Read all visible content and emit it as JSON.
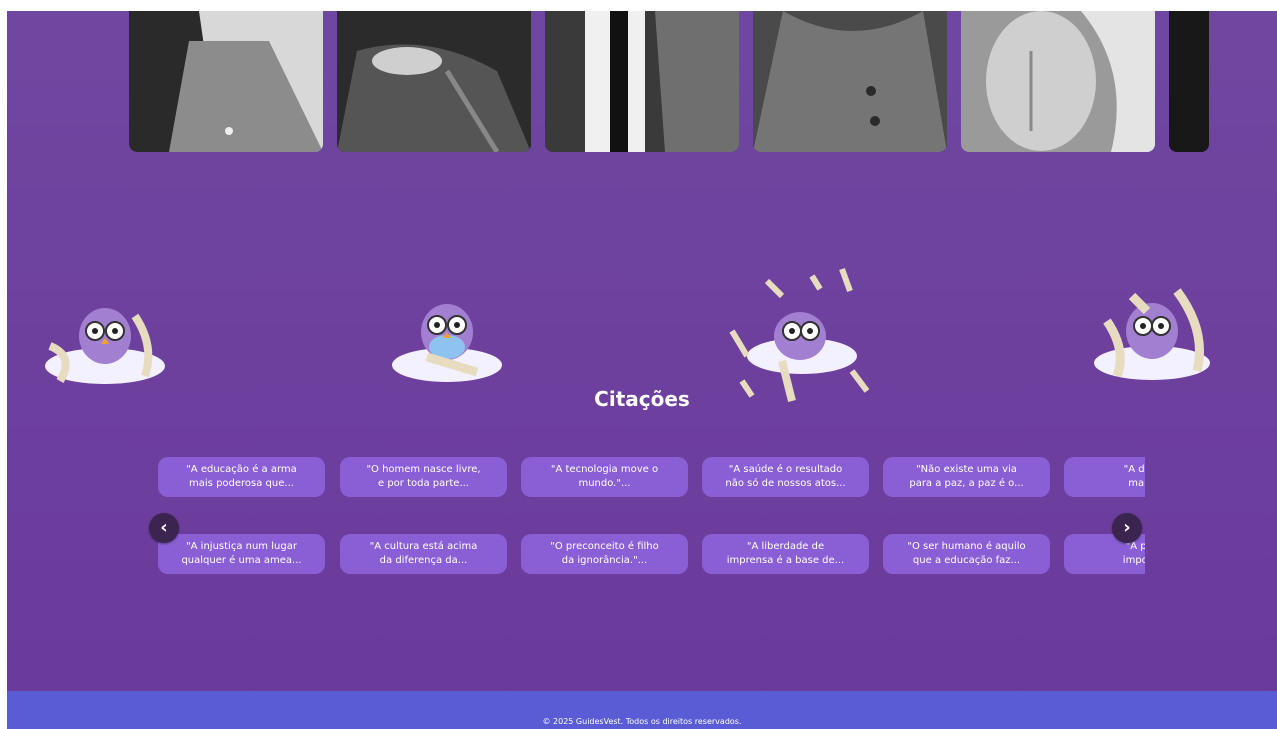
{
  "section": {
    "title": "Citações"
  },
  "quotes": [
    "\"A educação é a arma\nmais poderosa que...",
    "\"O homem nasce livre,\ne por toda parte...",
    "\"A tecnologia move o\nmundo.\"...",
    "\"A saúde é o resultado\nnão só de nossos atos...",
    "\"Não existe uma via\npara a paz, a paz é o...",
    "\"A desigu\nmaior d",
    "\"A injustiça num lugar\nqualquer é uma amea...",
    "\"A cultura está acima\nda diferença da...",
    "\"O preconceito é filho\nda ignorância.\"...",
    "\"A liberdade de\nimprensa é a base de...",
    "\"O ser humano é aquilo\nque a educação faz...",
    "\"A prime\nimportant"
  ],
  "nav": {
    "prev_icon": "chevron-left-icon",
    "next_icon": "chevron-right-icon",
    "prev_glyph": "‹",
    "next_glyph": "›"
  },
  "footer": {
    "text": "© 2025 GuidesVest. Todos os direitos reservados."
  },
  "colors": {
    "background": "#6d3f9e",
    "card": "#8a5fd6",
    "footer": "#5a5cd6",
    "arrow": "#3b2550"
  }
}
